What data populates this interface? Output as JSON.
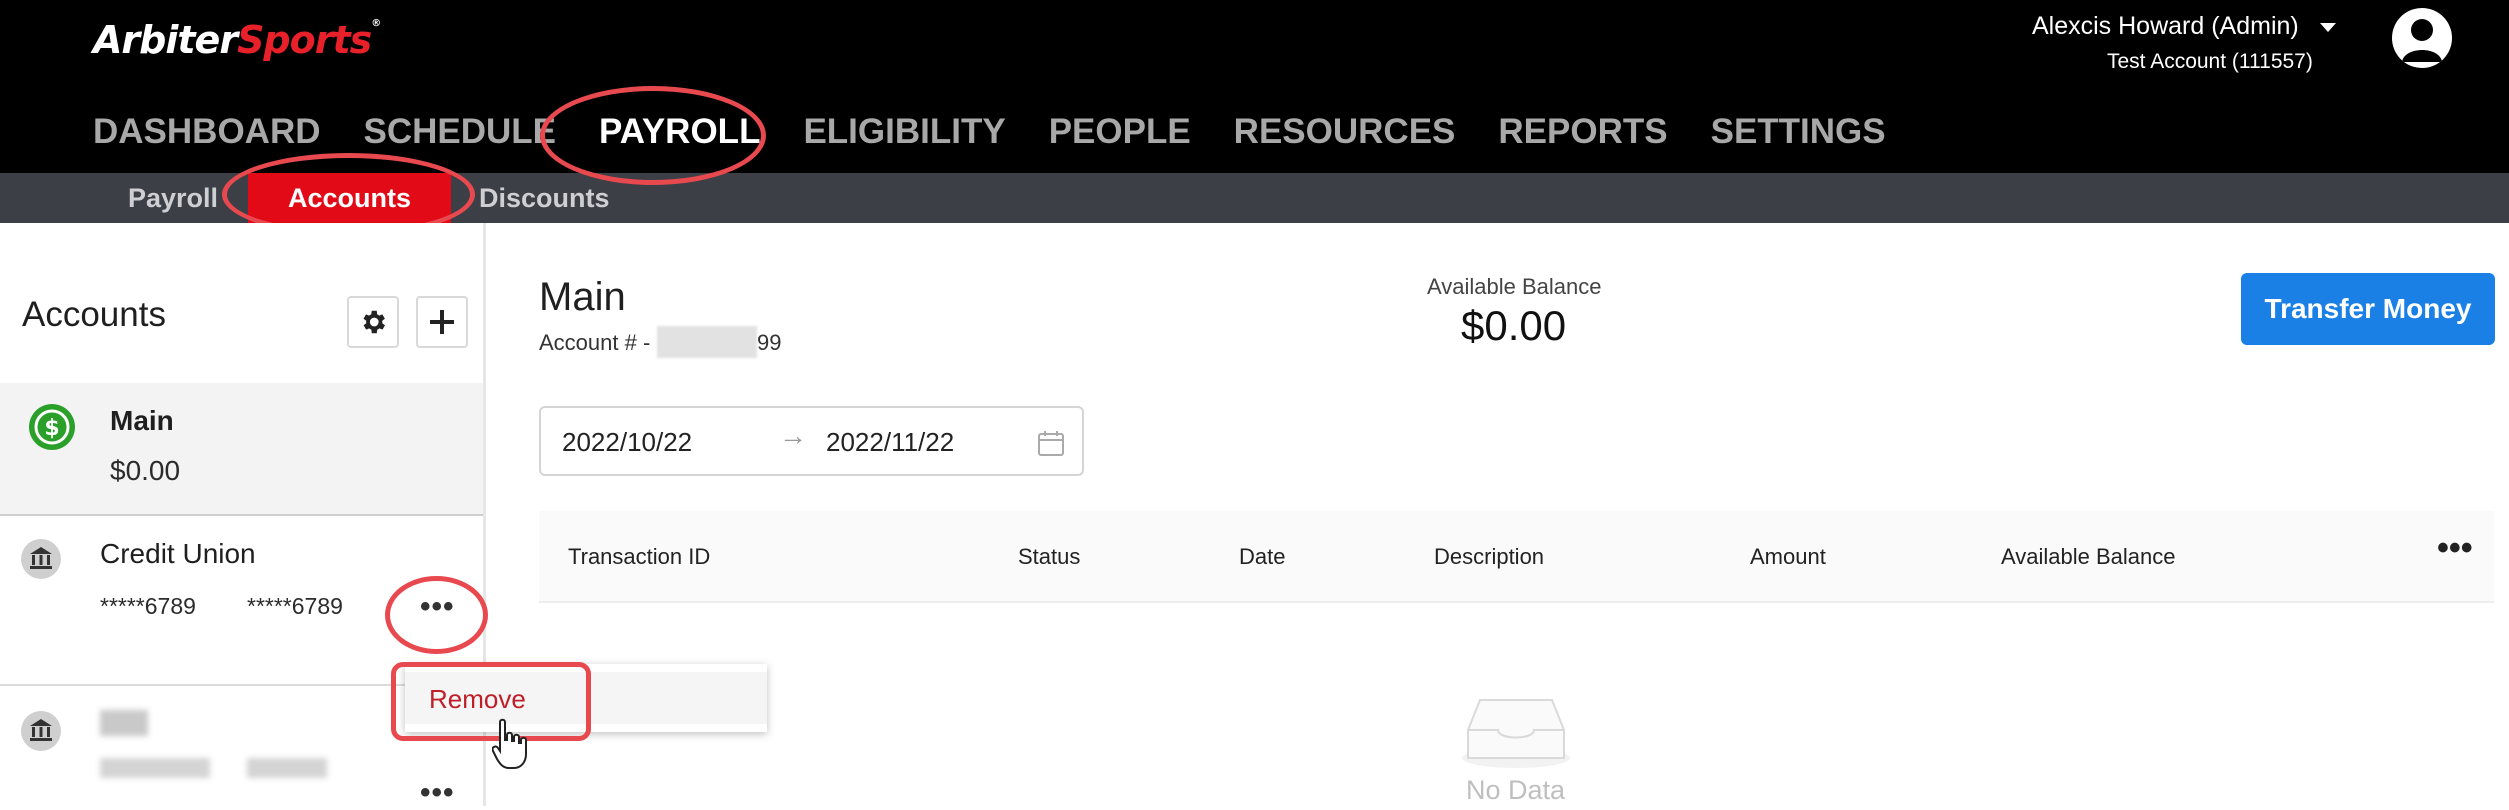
{
  "header": {
    "logo_part1": "Arbiter",
    "logo_part2": "Sports",
    "logo_mark": "®",
    "user_name": "Alexcis Howard (Admin)",
    "account": "Test Account (111557)"
  },
  "nav": [
    {
      "label": "DASHBOARD"
    },
    {
      "label": "SCHEDULE"
    },
    {
      "label": "PAYROLL"
    },
    {
      "label": "ELIGIBILITY"
    },
    {
      "label": "PEOPLE"
    },
    {
      "label": "RESOURCES"
    },
    {
      "label": "REPORTS"
    },
    {
      "label": "SETTINGS"
    }
  ],
  "subnav": [
    {
      "label": "Payroll"
    },
    {
      "label": "Accounts"
    },
    {
      "label": "Discounts"
    }
  ],
  "sidebar": {
    "title": "Accounts",
    "accounts": [
      {
        "name": "Main",
        "balance": "$0.00",
        "icon": "dollar-circle-icon"
      },
      {
        "name": "Credit Union",
        "number1": "*****6789",
        "number2": "*****6789",
        "icon": "bank-icon"
      },
      {
        "name": "",
        "icon": "bank-icon"
      }
    ],
    "menu": {
      "remove_label": "Remove"
    }
  },
  "main": {
    "title": "Main",
    "account_prefix": "Account # -",
    "account_suffix": "99",
    "available_label": "Available Balance",
    "available_value": "$0.00",
    "transfer_label": "Transfer Money",
    "date_start": "2022/10/22",
    "date_end": "2022/11/22",
    "date_arrow": "→",
    "columns": [
      "Transaction ID",
      "Status",
      "Date",
      "Description",
      "Amount",
      "Available Balance"
    ],
    "empty_text": "No Data"
  },
  "colors": {
    "accent_red": "#e20a17",
    "transfer_blue": "#1a80e6",
    "annotation_red": "#e8494f",
    "main_icon_green": "#2aa02a"
  }
}
